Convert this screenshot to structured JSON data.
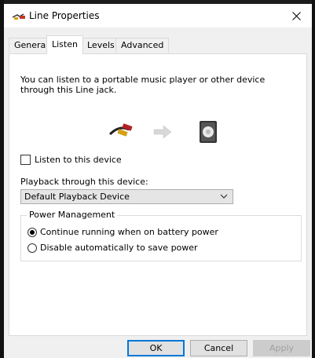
{
  "window": {
    "title": "Line Properties",
    "icon": "line-in-jack-icon"
  },
  "tabs": [
    {
      "label": "General",
      "active": false
    },
    {
      "label": "Listen",
      "active": true
    },
    {
      "label": "Levels",
      "active": false
    },
    {
      "label": "Advanced",
      "active": false
    }
  ],
  "listen": {
    "description": "You can listen to a portable music player or other device through this Line jack.",
    "listen_checkbox_label": "Listen to this device",
    "listen_checked": false,
    "playback_label": "Playback through this device:",
    "playback_device": "Default Playback Device",
    "power_management": {
      "legend": "Power Management",
      "option_continue": "Continue running when on battery power",
      "option_disable": "Disable automatically to save power",
      "selected": "continue"
    }
  },
  "buttons": {
    "ok": "OK",
    "cancel": "Cancel",
    "apply": "Apply"
  },
  "colors": {
    "accent": "#0078d7",
    "panel": "#ffffff",
    "window": "#f0f0f0"
  }
}
